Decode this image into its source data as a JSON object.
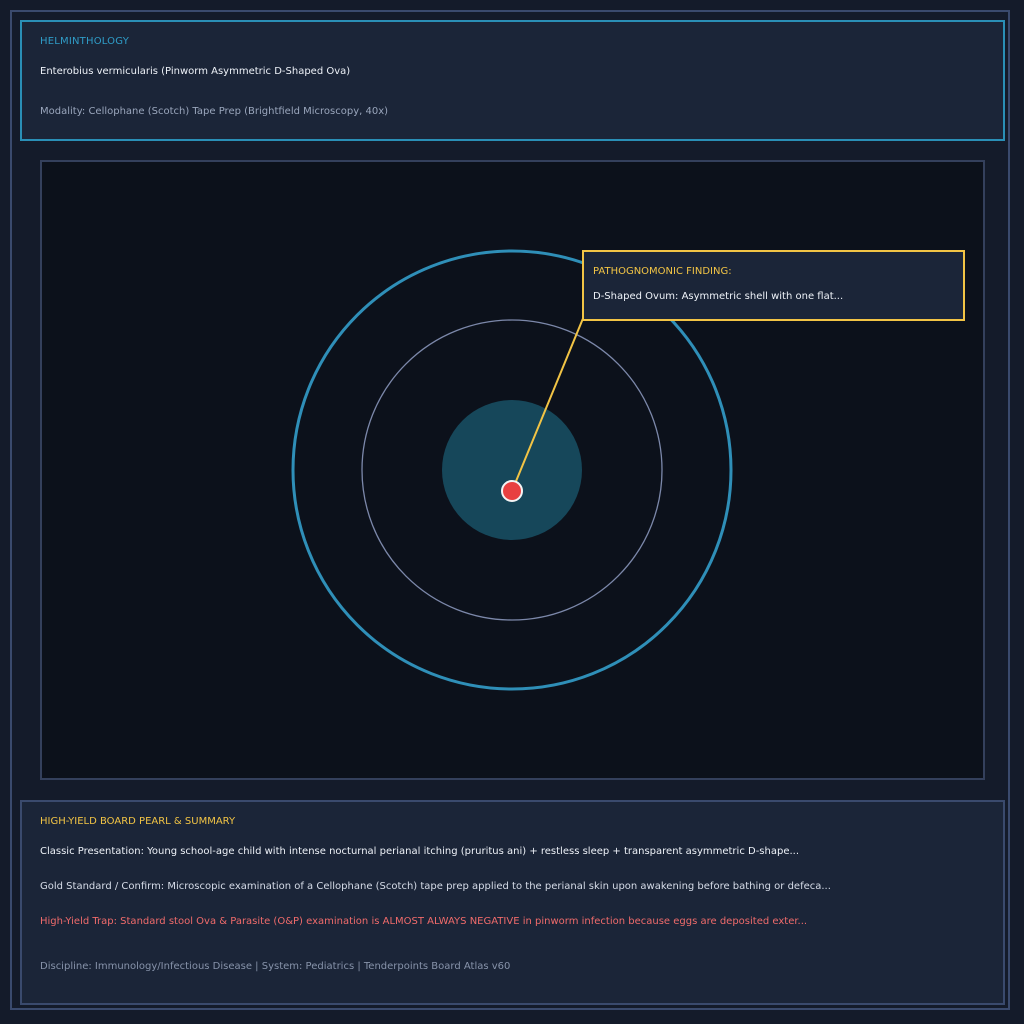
{
  "header": {
    "category": "HELMINTHOLOGY",
    "title": "Enterobius vermicularis (Pinworm Asymmetric D-Shaped Ova)",
    "modality": "Modality: Cellophane (Scotch) Tape Prep (Brightfield Microscopy, 40x)"
  },
  "callout": {
    "heading": "PATHOGNOMONIC FINDING:",
    "text": "D-Shaped Ovum: Asymmetric shell with one flat..."
  },
  "pearl": {
    "heading": "HIGH-YIELD BOARD PEARL & SUMMARY",
    "presentation": "Classic Presentation: Young school-age child with intense nocturnal perianal itching (pruritus ani) + restless sleep + transparent asymmetric D-shape...",
    "gold_standard": "Gold Standard / Confirm: Microscopic examination of a Cellophane (Scotch) tape prep applied to the perianal skin upon awakening before bathing or defeca...",
    "trap": "High-Yield Trap: Standard stool Ova & Parasite (O&P) examination is ALMOST ALWAYS NEGATIVE in pinworm infection because eggs are deposited exter...",
    "footer": "Discipline: Immunology/Infectious Disease | System: Pediatrics | Tenderpoints Board Atlas v60"
  },
  "colors": {
    "accent": "#2a8fb6",
    "highlight": "#f2c445",
    "marker": "#e84040",
    "trap": "#f06b6b"
  }
}
